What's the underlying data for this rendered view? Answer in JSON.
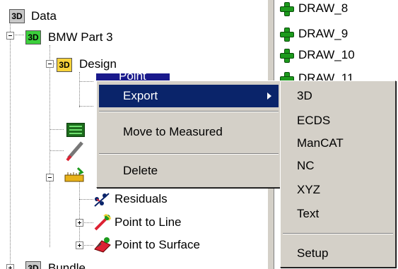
{
  "tree": {
    "root_label": "Data",
    "root_icon": "3D",
    "part_label": "BMW Part 3",
    "part_icon": "3D",
    "design_label": "Design",
    "design_icon": "3D",
    "selected_partial_label": "Point",
    "residuals_label": "Residuals",
    "point_to_line_label": "Point to Line",
    "point_to_surface_label": "Point to Surface",
    "bundle_label": "Bundle",
    "bundle_icon": "3D"
  },
  "draw_list": {
    "items": [
      "DRAW_8",
      "DRAW_9",
      "DRAW_10",
      "DRAW_11"
    ]
  },
  "context_menu": {
    "items": [
      "Export",
      "Move to Measured",
      "Delete"
    ]
  },
  "export_submenu": {
    "items": [
      "3D",
      "ECDS",
      "ManCAT",
      "NC",
      "XYZ",
      "Text"
    ],
    "setup_label": "Setup"
  },
  "colors": {
    "menu_highlight": "#0a246a",
    "menu_background": "#d4d0c8",
    "add_icon_green": "#1c9a1c"
  }
}
